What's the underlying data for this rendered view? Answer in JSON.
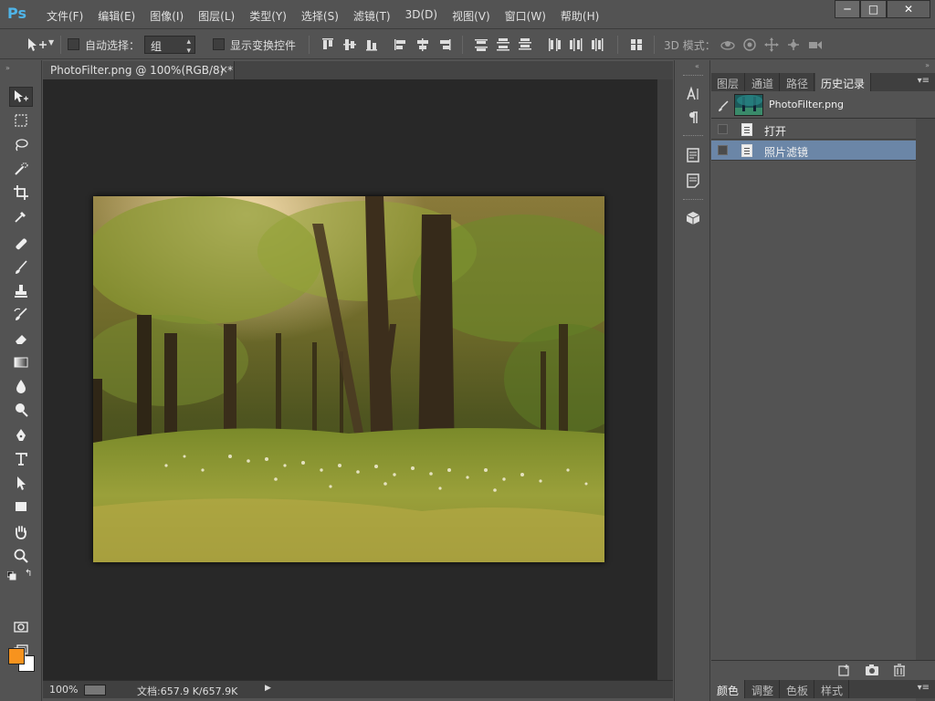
{
  "app": {
    "logo": "Ps"
  },
  "menu": [
    "文件(F)",
    "编辑(E)",
    "图像(I)",
    "图层(L)",
    "类型(Y)",
    "选择(S)",
    "滤镜(T)",
    "3D(D)",
    "视图(V)",
    "窗口(W)",
    "帮助(H)"
  ],
  "window_controls": {
    "minimize": "─",
    "maximize": "□",
    "close": "✕"
  },
  "options": {
    "auto_select_label": "自动选择：",
    "auto_select_value": "组",
    "show_transform_label": "显示变换控件",
    "mode_3d_label": "3D 模式："
  },
  "document": {
    "tab_title": "PhotoFilter.png @ 100%(RGB/8) *",
    "tab_close": "×",
    "zoom": "100%",
    "doc_size": "文档:657.9 K/657.9K"
  },
  "panels": {
    "top_tabs": [
      "图层",
      "通道",
      "路径",
      "历史记录"
    ],
    "active_tab_index": 3,
    "history": {
      "snapshot_name": "PhotoFilter.png",
      "items": [
        "打开",
        "照片滤镜"
      ],
      "selected_index": 1
    },
    "bottom_tabs": [
      "颜色",
      "调整",
      "色板",
      "样式"
    ],
    "bottom_active_index": 0
  },
  "colors": {
    "foreground": "#f7931e",
    "background": "#ffffff",
    "selection": "#6b86a7",
    "canvas_bg": "#282828",
    "ui_bg": "#535353"
  },
  "tools": [
    "move-tool-icon",
    "marquee-tool-icon",
    "lasso-tool-icon",
    "quick-select-tool-icon",
    "crop-tool-icon",
    "eyedropper-tool-icon",
    "healing-brush-tool-icon",
    "brush-tool-icon",
    "clone-stamp-tool-icon",
    "history-brush-tool-icon",
    "eraser-tool-icon",
    "gradient-tool-icon",
    "blur-tool-icon",
    "dodge-tool-icon",
    "pen-tool-icon",
    "type-tool-icon",
    "path-select-tool-icon",
    "shape-tool-icon",
    "hand-tool-icon",
    "zoom-tool-icon"
  ]
}
